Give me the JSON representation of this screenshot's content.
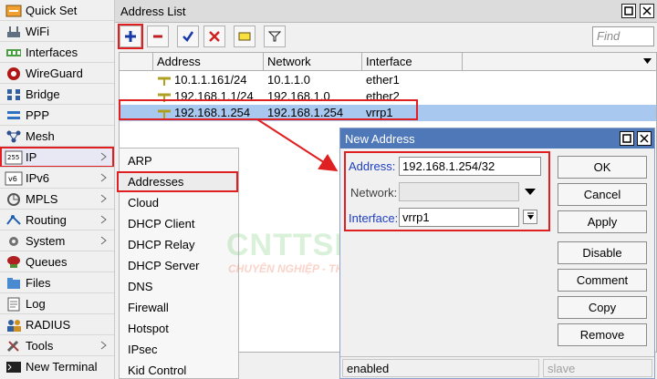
{
  "sidebar": {
    "items": [
      {
        "label": "Quick Set",
        "icon": "quick-set-icon"
      },
      {
        "label": "WiFi",
        "icon": "wifi-icon"
      },
      {
        "label": "Interfaces",
        "icon": "interfaces-icon"
      },
      {
        "label": "WireGuard",
        "icon": "wireguard-icon"
      },
      {
        "label": "Bridge",
        "icon": "bridge-icon"
      },
      {
        "label": "PPP",
        "icon": "ppp-icon"
      },
      {
        "label": "Mesh",
        "icon": "mesh-icon"
      },
      {
        "label": "IP",
        "icon": "ip-icon"
      },
      {
        "label": "IPv6",
        "icon": "ipv6-icon"
      },
      {
        "label": "MPLS",
        "icon": "mpls-icon"
      },
      {
        "label": "Routing",
        "icon": "routing-icon"
      },
      {
        "label": "System",
        "icon": "system-icon"
      },
      {
        "label": "Queues",
        "icon": "queues-icon"
      },
      {
        "label": "Files",
        "icon": "files-icon"
      },
      {
        "label": "Log",
        "icon": "log-icon"
      },
      {
        "label": "RADIUS",
        "icon": "radius-icon"
      },
      {
        "label": "Tools",
        "icon": "tools-icon"
      },
      {
        "label": "New Terminal",
        "icon": "terminal-icon"
      }
    ]
  },
  "submenu": {
    "items": [
      "ARP",
      "Addresses",
      "Cloud",
      "DHCP Client",
      "DHCP Relay",
      "DHCP Server",
      "DNS",
      "Firewall",
      "Hotspot",
      "IPsec",
      "Kid Control"
    ]
  },
  "address_list": {
    "title": "Address List",
    "find_placeholder": "Find",
    "columns": [
      "Address",
      "Network",
      "Interface"
    ],
    "rows": [
      {
        "address": "10.1.1.161/24",
        "network": "10.1.1.0",
        "interface": "ether1"
      },
      {
        "address": "192.168.1.1/24",
        "network": "192.168.1.0",
        "interface": "ether2"
      },
      {
        "address": "192.168.1.254",
        "network": "192.168.1.254",
        "interface": "vrrp1"
      }
    ]
  },
  "dialog": {
    "title": "New Address",
    "address_label": "Address:",
    "address_value": "192.168.1.254/32",
    "network_label": "Network:",
    "network_value": "",
    "interface_label": "Interface:",
    "interface_value": "vrrp1",
    "buttons": [
      "OK",
      "Cancel",
      "Apply",
      "Disable",
      "Comment",
      "Copy",
      "Remove"
    ],
    "status_enabled": "enabled",
    "status_slave": "slave"
  },
  "watermark": {
    "brand": "CNTTSHOP.vn",
    "slogan": "CHUYÊN NGHIỆP - THÂN THIỆN"
  },
  "colors": {
    "highlight_red": "#e02020",
    "selection_blue": "#a8c8f0",
    "dialog_title": "#4f78b8",
    "label_blue": "#2040c0"
  }
}
